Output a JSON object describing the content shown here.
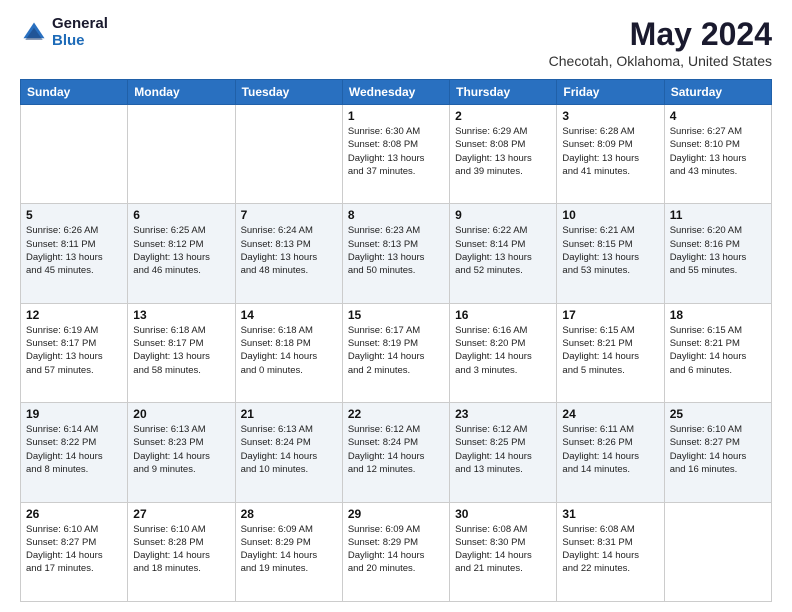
{
  "header": {
    "logo_general": "General",
    "logo_blue": "Blue",
    "month_title": "May 2024",
    "location": "Checotah, Oklahoma, United States"
  },
  "days_of_week": [
    "Sunday",
    "Monday",
    "Tuesday",
    "Wednesday",
    "Thursday",
    "Friday",
    "Saturday"
  ],
  "weeks": [
    [
      {
        "day": "",
        "info": ""
      },
      {
        "day": "",
        "info": ""
      },
      {
        "day": "",
        "info": ""
      },
      {
        "day": "1",
        "info": "Sunrise: 6:30 AM\nSunset: 8:08 PM\nDaylight: 13 hours\nand 37 minutes."
      },
      {
        "day": "2",
        "info": "Sunrise: 6:29 AM\nSunset: 8:08 PM\nDaylight: 13 hours\nand 39 minutes."
      },
      {
        "day": "3",
        "info": "Sunrise: 6:28 AM\nSunset: 8:09 PM\nDaylight: 13 hours\nand 41 minutes."
      },
      {
        "day": "4",
        "info": "Sunrise: 6:27 AM\nSunset: 8:10 PM\nDaylight: 13 hours\nand 43 minutes."
      }
    ],
    [
      {
        "day": "5",
        "info": "Sunrise: 6:26 AM\nSunset: 8:11 PM\nDaylight: 13 hours\nand 45 minutes."
      },
      {
        "day": "6",
        "info": "Sunrise: 6:25 AM\nSunset: 8:12 PM\nDaylight: 13 hours\nand 46 minutes."
      },
      {
        "day": "7",
        "info": "Sunrise: 6:24 AM\nSunset: 8:13 PM\nDaylight: 13 hours\nand 48 minutes."
      },
      {
        "day": "8",
        "info": "Sunrise: 6:23 AM\nSunset: 8:13 PM\nDaylight: 13 hours\nand 50 minutes."
      },
      {
        "day": "9",
        "info": "Sunrise: 6:22 AM\nSunset: 8:14 PM\nDaylight: 13 hours\nand 52 minutes."
      },
      {
        "day": "10",
        "info": "Sunrise: 6:21 AM\nSunset: 8:15 PM\nDaylight: 13 hours\nand 53 minutes."
      },
      {
        "day": "11",
        "info": "Sunrise: 6:20 AM\nSunset: 8:16 PM\nDaylight: 13 hours\nand 55 minutes."
      }
    ],
    [
      {
        "day": "12",
        "info": "Sunrise: 6:19 AM\nSunset: 8:17 PM\nDaylight: 13 hours\nand 57 minutes."
      },
      {
        "day": "13",
        "info": "Sunrise: 6:18 AM\nSunset: 8:17 PM\nDaylight: 13 hours\nand 58 minutes."
      },
      {
        "day": "14",
        "info": "Sunrise: 6:18 AM\nSunset: 8:18 PM\nDaylight: 14 hours\nand 0 minutes."
      },
      {
        "day": "15",
        "info": "Sunrise: 6:17 AM\nSunset: 8:19 PM\nDaylight: 14 hours\nand 2 minutes."
      },
      {
        "day": "16",
        "info": "Sunrise: 6:16 AM\nSunset: 8:20 PM\nDaylight: 14 hours\nand 3 minutes."
      },
      {
        "day": "17",
        "info": "Sunrise: 6:15 AM\nSunset: 8:21 PM\nDaylight: 14 hours\nand 5 minutes."
      },
      {
        "day": "18",
        "info": "Sunrise: 6:15 AM\nSunset: 8:21 PM\nDaylight: 14 hours\nand 6 minutes."
      }
    ],
    [
      {
        "day": "19",
        "info": "Sunrise: 6:14 AM\nSunset: 8:22 PM\nDaylight: 14 hours\nand 8 minutes."
      },
      {
        "day": "20",
        "info": "Sunrise: 6:13 AM\nSunset: 8:23 PM\nDaylight: 14 hours\nand 9 minutes."
      },
      {
        "day": "21",
        "info": "Sunrise: 6:13 AM\nSunset: 8:24 PM\nDaylight: 14 hours\nand 10 minutes."
      },
      {
        "day": "22",
        "info": "Sunrise: 6:12 AM\nSunset: 8:24 PM\nDaylight: 14 hours\nand 12 minutes."
      },
      {
        "day": "23",
        "info": "Sunrise: 6:12 AM\nSunset: 8:25 PM\nDaylight: 14 hours\nand 13 minutes."
      },
      {
        "day": "24",
        "info": "Sunrise: 6:11 AM\nSunset: 8:26 PM\nDaylight: 14 hours\nand 14 minutes."
      },
      {
        "day": "25",
        "info": "Sunrise: 6:10 AM\nSunset: 8:27 PM\nDaylight: 14 hours\nand 16 minutes."
      }
    ],
    [
      {
        "day": "26",
        "info": "Sunrise: 6:10 AM\nSunset: 8:27 PM\nDaylight: 14 hours\nand 17 minutes."
      },
      {
        "day": "27",
        "info": "Sunrise: 6:10 AM\nSunset: 8:28 PM\nDaylight: 14 hours\nand 18 minutes."
      },
      {
        "day": "28",
        "info": "Sunrise: 6:09 AM\nSunset: 8:29 PM\nDaylight: 14 hours\nand 19 minutes."
      },
      {
        "day": "29",
        "info": "Sunrise: 6:09 AM\nSunset: 8:29 PM\nDaylight: 14 hours\nand 20 minutes."
      },
      {
        "day": "30",
        "info": "Sunrise: 6:08 AM\nSunset: 8:30 PM\nDaylight: 14 hours\nand 21 minutes."
      },
      {
        "day": "31",
        "info": "Sunrise: 6:08 AM\nSunset: 8:31 PM\nDaylight: 14 hours\nand 22 minutes."
      },
      {
        "day": "",
        "info": ""
      }
    ]
  ]
}
